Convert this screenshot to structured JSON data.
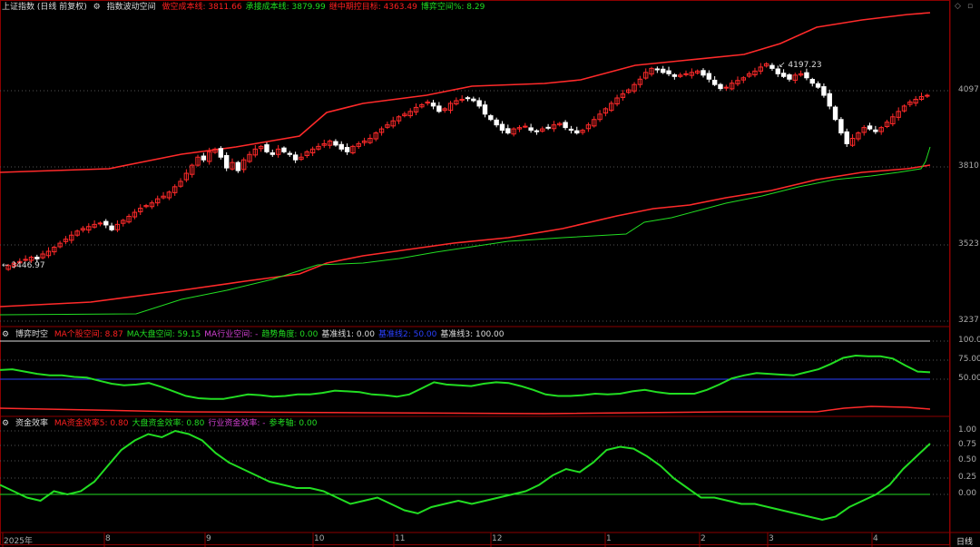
{
  "header_main": {
    "symbol": "上证指数 (日线 前复权)",
    "indicator": "指数波动空间",
    "items": [
      {
        "label": "做空成本线",
        "value": "3811.66",
        "color": "#ff2020"
      },
      {
        "label": "承接成本线",
        "value": "3879.99",
        "color": "#22dd22"
      },
      {
        "label": "继中期控目标",
        "value": "4363.49",
        "color": "#ff2020"
      },
      {
        "label": "博弈空间%",
        "value": "8.29",
        "color": "#22dd22"
      }
    ]
  },
  "header_mid": {
    "indicator": "博弈时空",
    "items": [
      {
        "label": "MA个股空间",
        "value": "8.87",
        "color": "#ff2020"
      },
      {
        "label": "MA大盘空间",
        "value": "59.15",
        "color": "#22dd22"
      },
      {
        "label": "MA行业空间",
        "value": "-",
        "color": "#d040d0"
      },
      {
        "label": "趋势角度",
        "value": "0.00",
        "color": "#22dd22"
      },
      {
        "label": "基准线1",
        "value": "0.00",
        "color": "#dddddd"
      },
      {
        "label": "基准线2",
        "value": "50.00",
        "color": "#2a40ff"
      },
      {
        "label": "基准线3",
        "value": "100.00",
        "color": "#dddddd"
      }
    ]
  },
  "header_low": {
    "indicator": "资金效率",
    "items": [
      {
        "label": "MA资金效率5",
        "value": "0.80",
        "color": "#ff2020"
      },
      {
        "label": "大盘资金效率",
        "value": "0.80",
        "color": "#22dd22"
      },
      {
        "label": "行业资金效率",
        "value": "-",
        "color": "#d040d0"
      },
      {
        "label": "参考轴",
        "value": "0.00",
        "color": "#22dd22"
      }
    ]
  },
  "price_axis": [
    "4097",
    "3810",
    "3523",
    "3237"
  ],
  "mid_axis": [
    "100.00",
    "75.00",
    "50.00"
  ],
  "low_axis": [
    "1.00",
    "0.75",
    "0.50",
    "0.25",
    "0.00"
  ],
  "x_axis": [
    "2025年",
    "8",
    "9",
    "10",
    "11",
    "12",
    "1",
    "2",
    "3",
    "4"
  ],
  "annotations": {
    "high": "4197.23",
    "low": "3446.97"
  },
  "period_label": "日线",
  "colors": {
    "up": "#ff2a2a",
    "down": "#ffffff",
    "green": "#22dd22",
    "blue": "#2a40ff",
    "grid": "#8b0000"
  },
  "chart_data": {
    "type": "candlestick",
    "price_range": [
      3180,
      4420
    ],
    "high_point": 4197.23,
    "low_point": 3446.97,
    "closes": [
      3447,
      3455,
      3462,
      3470,
      3478,
      3472,
      3490,
      3500,
      3515,
      3530,
      3545,
      3560,
      3575,
      3585,
      3592,
      3600,
      3605,
      3598,
      3580,
      3600,
      3615,
      3630,
      3645,
      3660,
      3670,
      3680,
      3695,
      3705,
      3720,
      3740,
      3760,
      3790,
      3820,
      3850,
      3840,
      3870,
      3880,
      3850,
      3810,
      3830,
      3800,
      3840,
      3860,
      3880,
      3890,
      3870,
      3860,
      3880,
      3870,
      3860,
      3840,
      3850,
      3870,
      3880,
      3890,
      3900,
      3910,
      3895,
      3880,
      3870,
      3890,
      3900,
      3910,
      3920,
      3940,
      3955,
      3970,
      3985,
      4000,
      4010,
      4020,
      4035,
      4045,
      4055,
      4040,
      4020,
      4030,
      4050,
      4060,
      4065,
      4070,
      4060,
      4040,
      4010,
      3990,
      3970,
      3950,
      3940,
      3955,
      3960,
      3965,
      3950,
      3945,
      3955,
      3960,
      3970,
      3975,
      3960,
      3950,
      3940,
      3950,
      3970,
      3990,
      4010,
      4030,
      4050,
      4070,
      4085,
      4100,
      4120,
      4140,
      4165,
      4180,
      4175,
      4165,
      4160,
      4150,
      4155,
      4160,
      4165,
      4170,
      4155,
      4140,
      4120,
      4105,
      4110,
      4125,
      4135,
      4145,
      4160,
      4170,
      4185,
      4197,
      4180,
      4160,
      4150,
      4140,
      4155,
      4160,
      4145,
      4125,
      4110,
      4080,
      4040,
      3990,
      3940,
      3900,
      3920,
      3940,
      3960,
      3955,
      3945,
      3960,
      3980,
      4000,
      4020,
      4040,
      4055,
      4065,
      4075,
      4080
    ],
    "upper_band_level": [
      3790,
      4400
    ],
    "lower_band_level": [
      3260,
      3810
    ],
    "green_cost_level": [
      3235,
      3920
    ],
    "mid_series": {
      "green_levels": [
        62,
        63,
        60,
        57,
        55,
        55,
        53,
        52,
        48,
        44,
        42,
        43,
        45,
        40,
        34,
        28,
        25,
        24,
        24,
        27,
        30,
        29,
        27,
        28,
        30,
        30,
        32,
        35,
        34,
        33,
        30,
        29,
        27,
        30,
        38,
        46,
        43,
        42,
        41,
        44,
        46,
        45,
        41,
        36,
        30,
        28,
        28,
        29,
        31,
        30,
        31,
        34,
        36,
        33,
        31,
        31,
        31,
        36,
        43,
        51,
        55,
        58,
        57,
        56,
        55,
        59,
        63,
        70,
        78,
        81,
        80,
        80,
        77,
        68,
        60,
        59
      ],
      "red_level": 8.87,
      "ref_blue": 50,
      "ref_white": 100
    },
    "low_series": {
      "green_levels": [
        0.15,
        0.05,
        -0.05,
        -0.1,
        0.05,
        0.0,
        0.05,
        0.2,
        0.45,
        0.7,
        0.85,
        0.95,
        0.9,
        1.0,
        0.95,
        0.85,
        0.65,
        0.5,
        0.4,
        0.3,
        0.2,
        0.15,
        0.1,
        0.1,
        0.05,
        -0.05,
        -0.15,
        -0.1,
        -0.05,
        -0.15,
        -0.25,
        -0.3,
        -0.2,
        -0.15,
        -0.1,
        -0.15,
        -0.1,
        -0.05,
        0.0,
        0.05,
        0.15,
        0.3,
        0.4,
        0.35,
        0.5,
        0.7,
        0.75,
        0.72,
        0.6,
        0.45,
        0.25,
        0.1,
        -0.05,
        -0.05,
        -0.1,
        -0.15,
        -0.15,
        -0.2,
        -0.25,
        -0.3,
        -0.35,
        -0.4,
        -0.35,
        -0.2,
        -0.1,
        0.0,
        0.15,
        0.4,
        0.6,
        0.8
      ],
      "ref_axis": 0.0
    }
  }
}
